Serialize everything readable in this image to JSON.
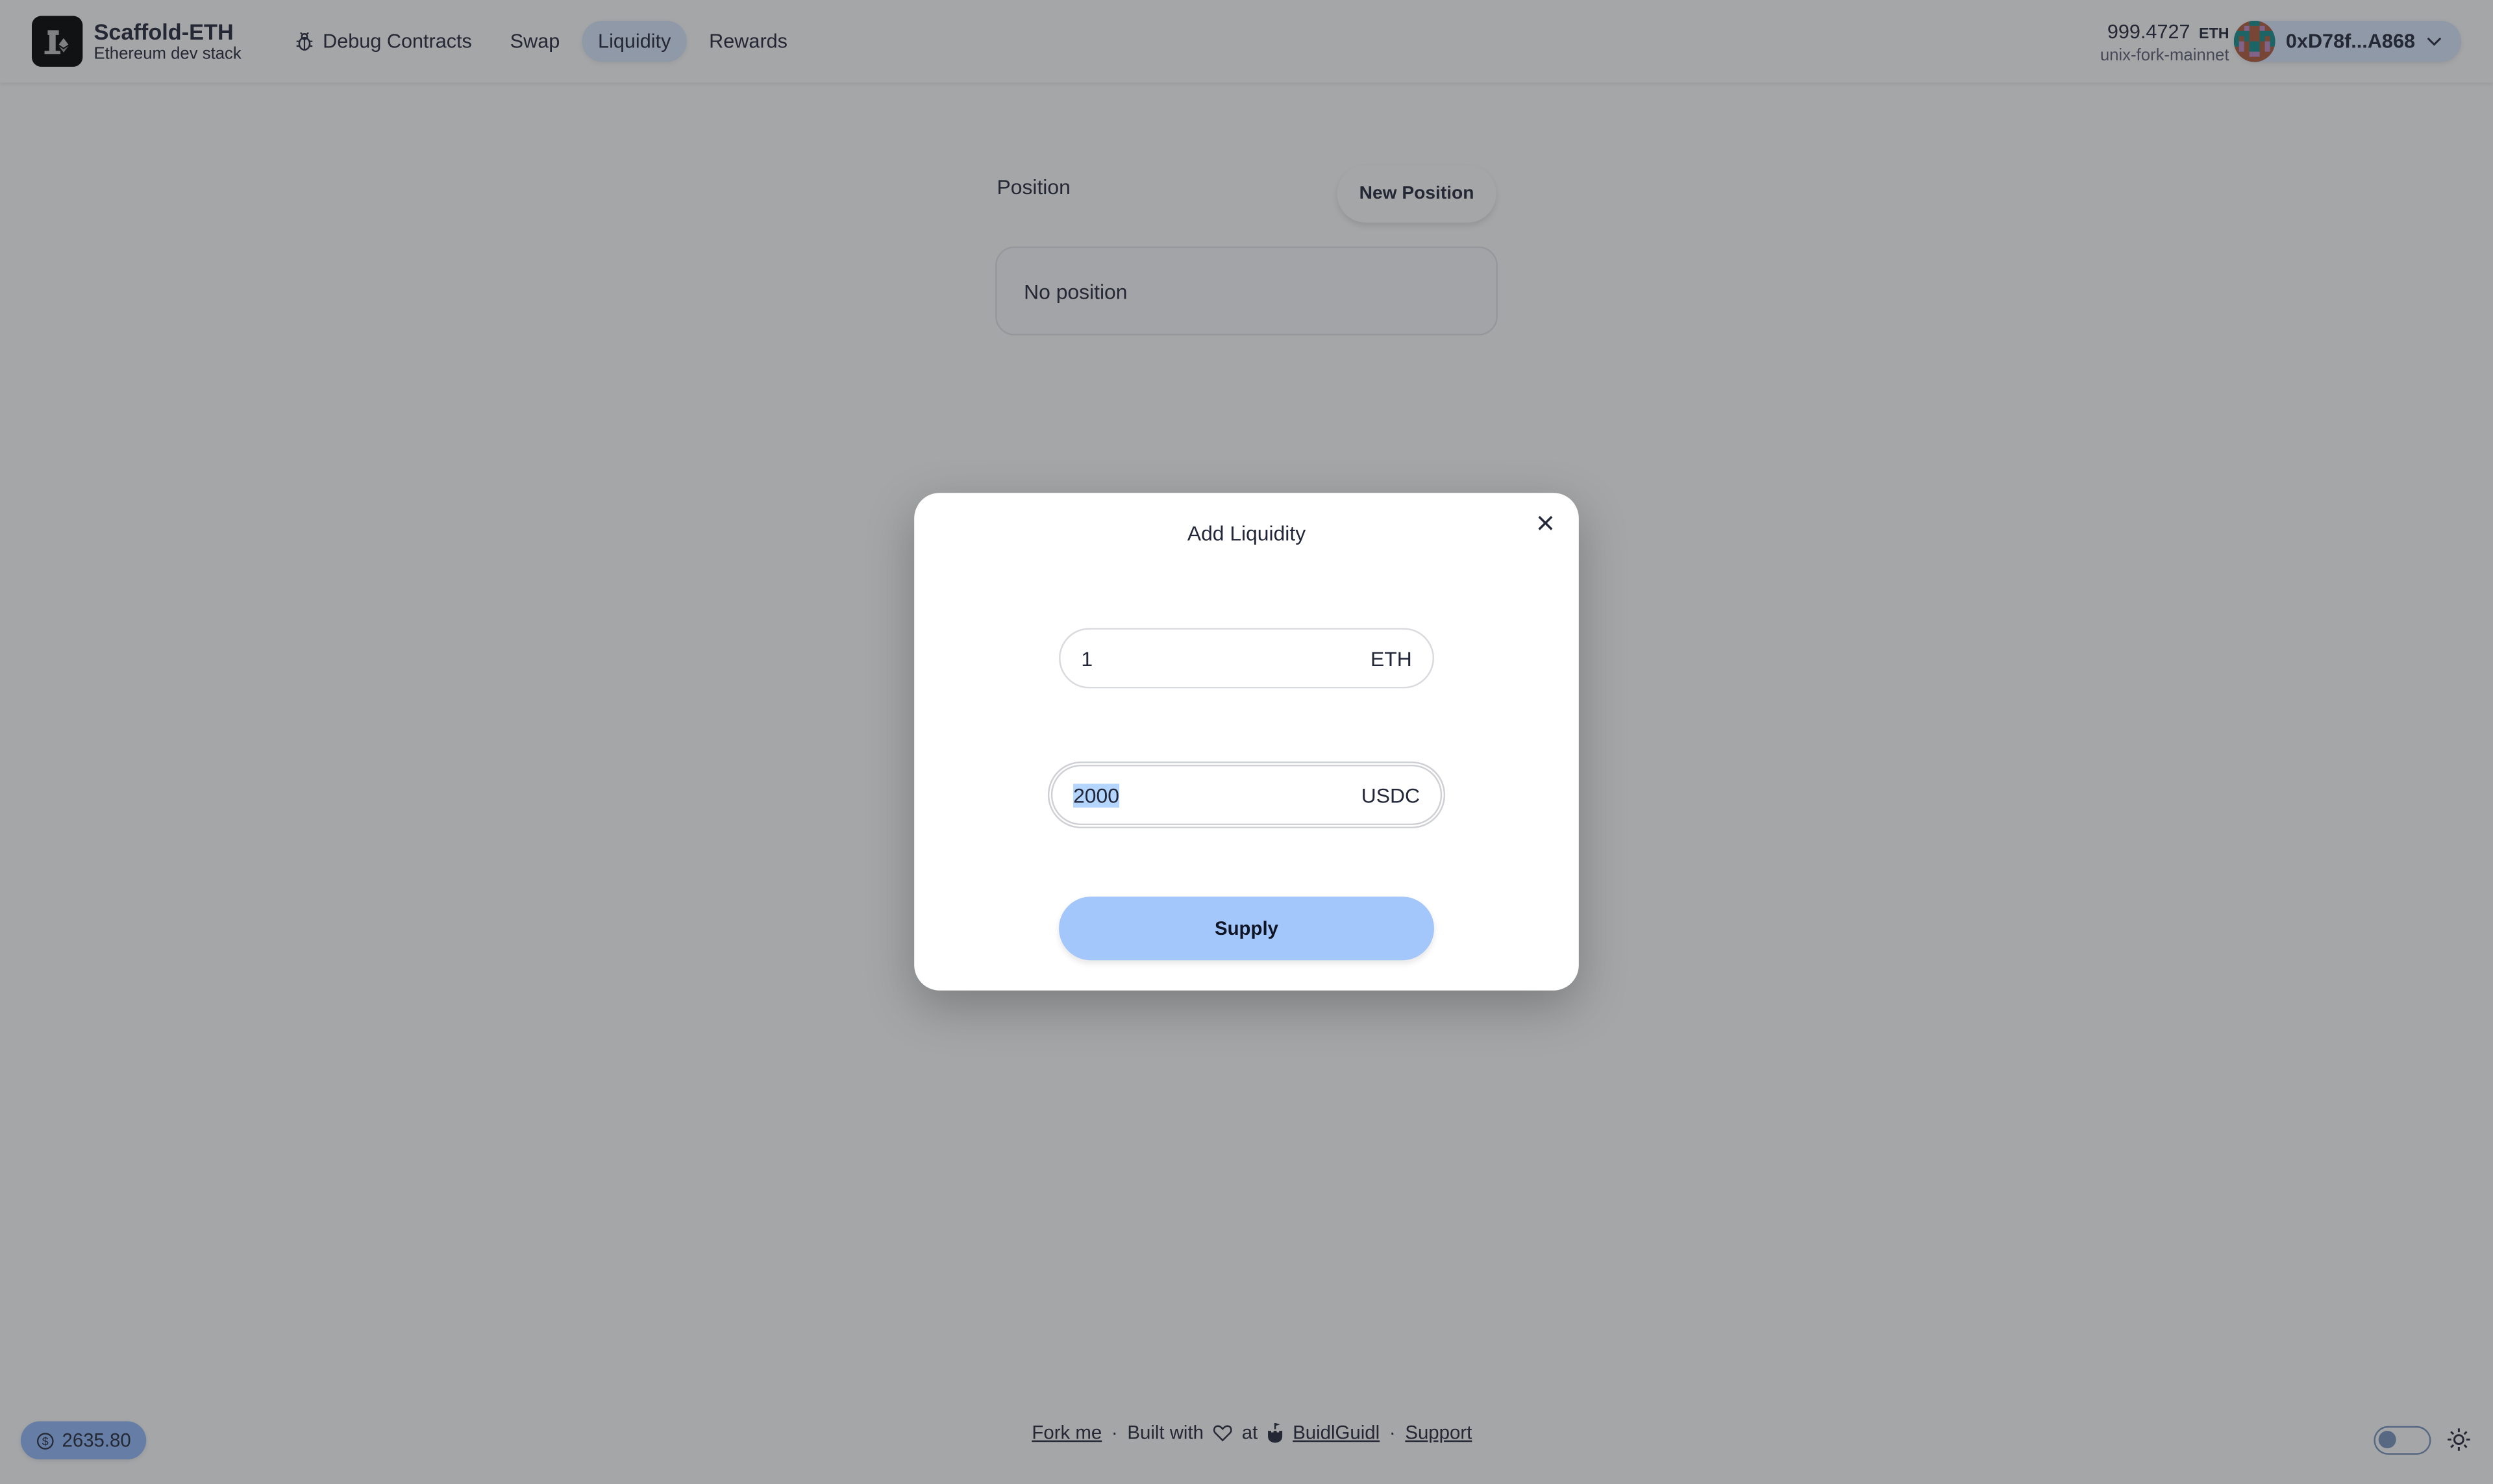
{
  "header": {
    "brand_title": "Scaffold-ETH",
    "brand_subtitle": "Ethereum dev stack",
    "nav": [
      {
        "label": "Debug Contracts",
        "icon": "bug-icon",
        "active": false
      },
      {
        "label": "Swap",
        "active": false
      },
      {
        "label": "Liquidity",
        "active": true
      },
      {
        "label": "Rewards",
        "active": false
      }
    ],
    "balance_value": "999.4727",
    "balance_unit": "ETH",
    "network": "unix-fork-mainnet",
    "account_address": "0xD78f...A868"
  },
  "main": {
    "positions_title": "Position",
    "new_position_label": "New Position",
    "empty_text": "No position"
  },
  "modal": {
    "title": "Add Liquidity",
    "eth_field": {
      "value": "1",
      "unit": "ETH"
    },
    "usdc_field": {
      "value": "2000",
      "unit": "USDC",
      "selected": true
    },
    "supply_label": "Supply"
  },
  "footer": {
    "price": "2635.80",
    "fork_label": "Fork me",
    "built_with": "Built with",
    "at": "at",
    "buidlguidl_label": "BuidlGuidl",
    "support_label": "Support",
    "separator": "·"
  },
  "colors": {
    "accent": "#93bbfb",
    "nav_active": "#dbe8fe",
    "supply_button": "#a4c7fb"
  }
}
